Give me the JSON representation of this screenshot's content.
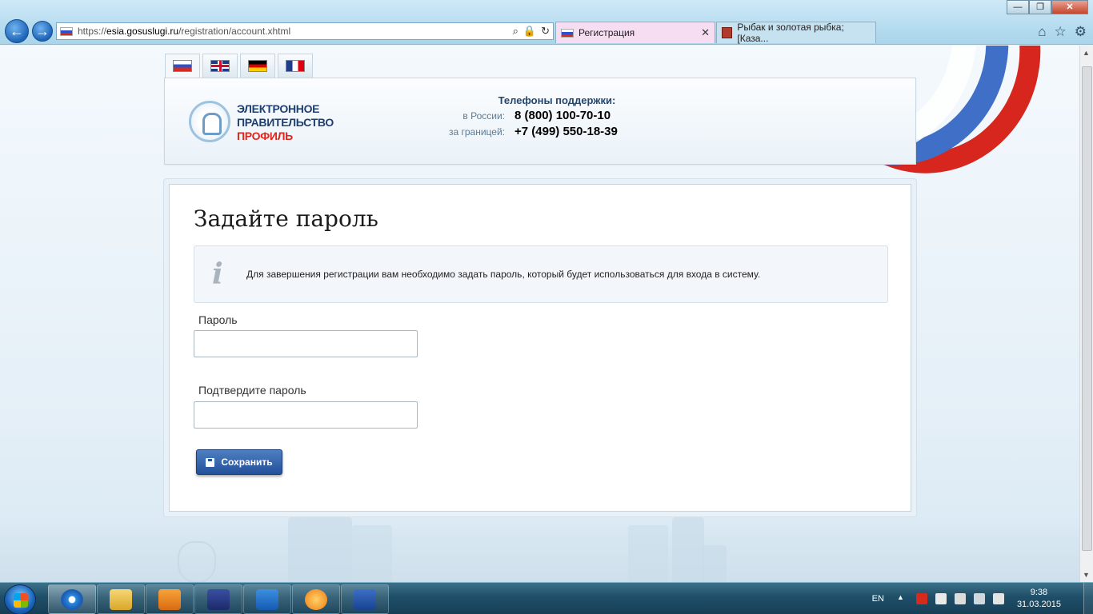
{
  "browser": {
    "url_prefix": "https://",
    "url_host": "esia.gosuslugi.ru",
    "url_path": "/registration/account.xhtml",
    "tabs": [
      {
        "label": "Регистрация",
        "active": true
      },
      {
        "label": "Рыбак и золотая рыбка; [Каза...",
        "active": false
      }
    ],
    "window_controls": {
      "minimize": "—",
      "restore": "❐",
      "close": "✕"
    }
  },
  "header": {
    "languages": [
      "ru",
      "en",
      "de",
      "fr"
    ],
    "logo_line1": "ЭЛЕКТРОННОЕ",
    "logo_line2": "ПРАВИТЕЛЬСТВО",
    "logo_line3": "ПРОФИЛЬ",
    "support_title": "Телефоны поддержки:",
    "support_rows": [
      {
        "label": "в России:",
        "phone": "8 (800) 100-70-10"
      },
      {
        "label": "за границей:",
        "phone": "+7 (499) 550-18-39"
      }
    ]
  },
  "form": {
    "title": "Задайте пароль",
    "info_text": "Для завершения регистрации вам необходимо задать пароль, который будет использоваться для входа в систему.",
    "password_label": "Пароль",
    "password_value": "",
    "confirm_label": "Подтвердите пароль",
    "confirm_value": "",
    "save_label": "Сохранить"
  },
  "taskbar": {
    "apps": [
      "internet-explorer",
      "file-explorer",
      "media-player",
      "floppy-app",
      "outlook",
      "vibrancy-app",
      "word"
    ],
    "lang": "EN",
    "time": "9:38",
    "date": "31.03.2015"
  },
  "colors": {
    "accent_blue": "#23509a",
    "brand_red": "#e1251b",
    "brand_navy": "#1f3f72"
  }
}
